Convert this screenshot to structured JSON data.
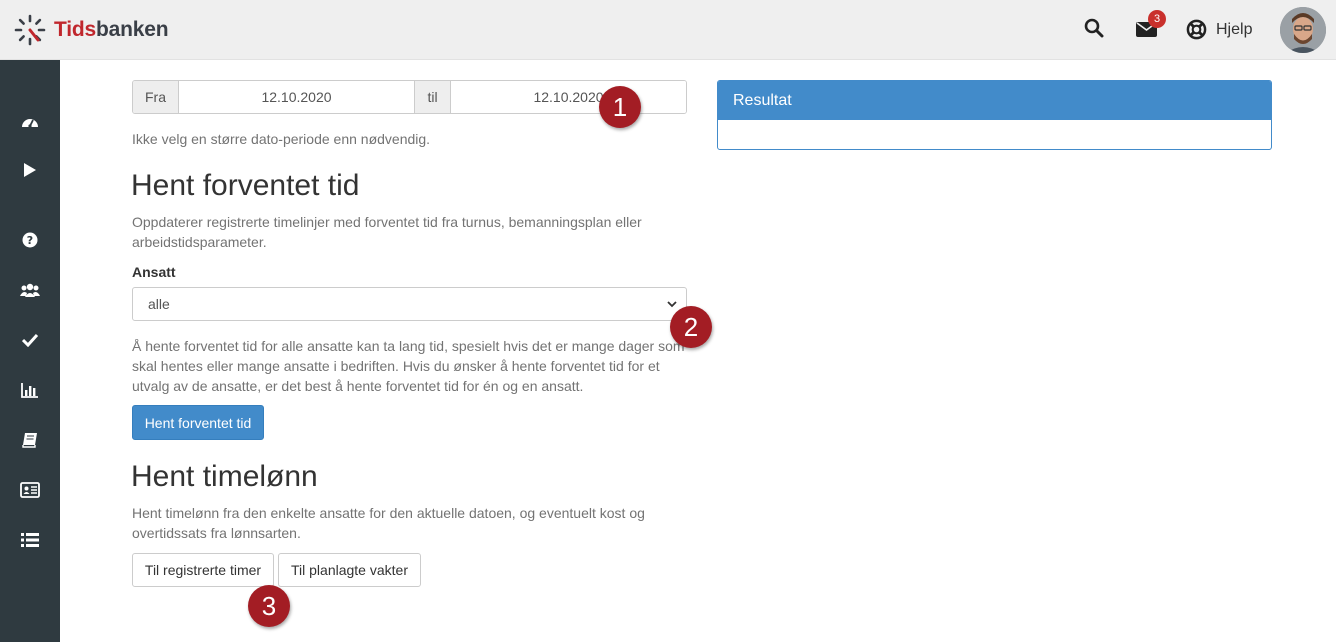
{
  "app": {
    "logo_part1": "Tids",
    "logo_part2": "banken"
  },
  "header": {
    "mail_count": "3",
    "help_label": "Hjelp"
  },
  "sidebar": {
    "items": [
      {
        "icon": "dashboard-icon"
      },
      {
        "icon": "play-icon"
      },
      {
        "icon": "question-icon"
      },
      {
        "icon": "users-icon"
      },
      {
        "icon": "check-icon"
      },
      {
        "icon": "bar-chart-icon"
      },
      {
        "icon": "book-icon"
      },
      {
        "icon": "id-card-icon"
      },
      {
        "icon": "list-icon"
      }
    ]
  },
  "date_range": {
    "from_label": "Fra",
    "from_value": "12.10.2020",
    "to_label": "til",
    "to_value": "12.10.2020",
    "hint": "Ikke velg en større dato-periode enn nødvendig."
  },
  "expected_time": {
    "title": "Hent forventet tid",
    "description": "Oppdaterer registrerte timelinjer med forventet tid fra turnus, bemanningsplan eller arbeidstidsparameter.",
    "employee_label": "Ansatt",
    "employee_value": "alle",
    "warning": "Å hente forventet tid for alle ansatte kan ta lang tid, spesielt hvis det er mange dager som skal hentes eller mange ansatte i bedriften. Hvis du ønsker å hente forventet tid for et utvalg av de ansatte, er det best å hente forventet tid for én og en ansatt.",
    "button": "Hent forventet tid"
  },
  "hourly_wage": {
    "title": "Hent timelønn",
    "description": "Hent timelønn fra den enkelte ansatte for den aktuelle datoen, og eventuelt kost og overtidssats fra lønnsarten.",
    "button_registered": "Til registrerte timer",
    "button_planned": "Til planlagte vakter"
  },
  "result_panel": {
    "title": "Resultat"
  },
  "markers": [
    "1",
    "2",
    "3"
  ],
  "colors": {
    "primary": "#428bca",
    "sidebar": "#2f3a40",
    "marker": "#a31d24",
    "badge": "#c9302c"
  }
}
